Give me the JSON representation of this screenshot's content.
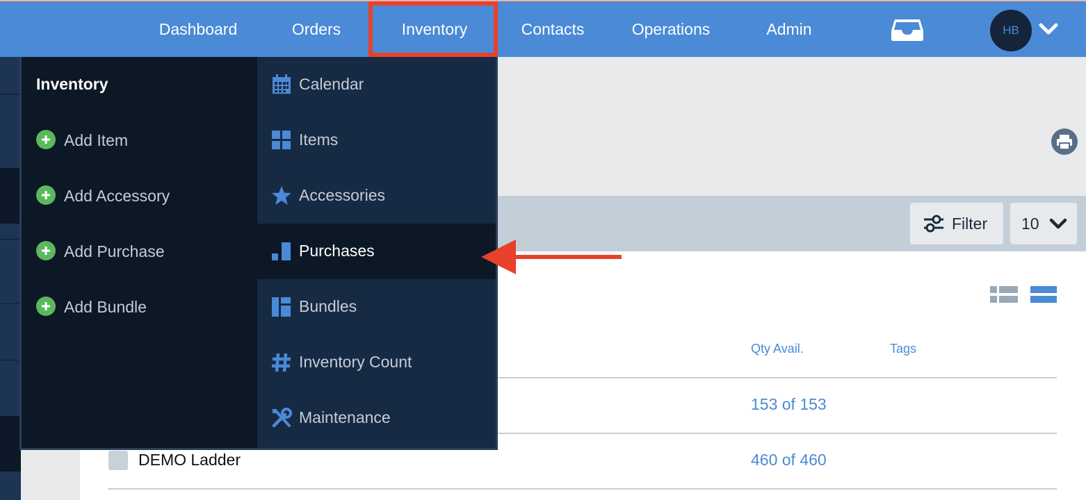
{
  "nav": {
    "items": [
      "Dashboard",
      "Orders",
      "Inventory",
      "Contacts",
      "Operations",
      "Admin"
    ],
    "active": "Inventory",
    "user_initials": "HB"
  },
  "dropdown": {
    "title": "Inventory",
    "actions": [
      "Add Item",
      "Add Accessory",
      "Add Purchase",
      "Add Bundle"
    ],
    "links": [
      {
        "label": "Calendar",
        "icon": "calendar-icon"
      },
      {
        "label": "Items",
        "icon": "grid-icon"
      },
      {
        "label": "Accessories",
        "icon": "star-icon"
      },
      {
        "label": "Purchases",
        "icon": "bar-chart-icon"
      },
      {
        "label": "Bundles",
        "icon": "bundles-icon"
      },
      {
        "label": "Inventory Count",
        "icon": "hash-icon"
      },
      {
        "label": "Maintenance",
        "icon": "wrench-icon"
      }
    ],
    "selected_link": "Purchases"
  },
  "toolbar": {
    "filter_label": "Filter",
    "per_page": "10"
  },
  "table": {
    "columns": [
      "Qty Avail.",
      "Tags"
    ],
    "rows": [
      {
        "name": "",
        "qty": "153 of 153"
      },
      {
        "name": "DEMO Ladder",
        "qty": "460 of 460"
      }
    ]
  },
  "colors": {
    "nav_bg": "#4a8ad6",
    "menu_bg": "#0c1826",
    "menu_panel": "#172a44",
    "accent": "#4a8ad6",
    "add_green": "#5cb85c",
    "highlight": "#e8412b"
  }
}
